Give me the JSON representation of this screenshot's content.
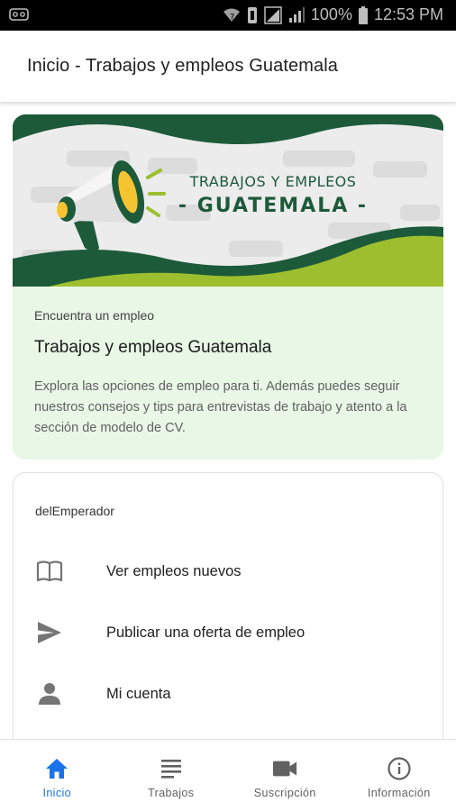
{
  "status_bar": {
    "battery": "100%",
    "time": "12:53 PM"
  },
  "app_bar": {
    "title": "Inicio - Trabajos y empleos Guatemala"
  },
  "hero": {
    "banner_line1": "TRABAJOS Y EMPLEOS",
    "banner_line2": "- GUATEMALA -",
    "overline": "Encuentra un empleo",
    "title": "Trabajos y empleos Guatemala",
    "description": "Explora las opciones de empleo para ti. Además puedes seguir nuestros consejos y tips para entrevistas de trabajo y atento a la sección de modelo de CV.",
    "colors": {
      "dark_green": "#1d5a3a",
      "lime": "#9dbf2f",
      "card_bg": "#e8f7e6"
    }
  },
  "menu": {
    "header": "delEmperador",
    "items": [
      {
        "label": "Ver empleos nuevos",
        "icon": "book-icon"
      },
      {
        "label": "Publicar una oferta de empleo",
        "icon": "send-icon"
      },
      {
        "label": "Mi cuenta",
        "icon": "person-icon"
      }
    ]
  },
  "bottom_nav": {
    "active_color": "#1a73e8",
    "items": [
      {
        "label": "Inicio",
        "icon": "home-icon",
        "active": true
      },
      {
        "label": "Trabajos",
        "icon": "list-icon",
        "active": false
      },
      {
        "label": "Suscripción",
        "icon": "video-camera-icon",
        "active": false
      },
      {
        "label": "Información",
        "icon": "info-icon",
        "active": false
      }
    ]
  }
}
